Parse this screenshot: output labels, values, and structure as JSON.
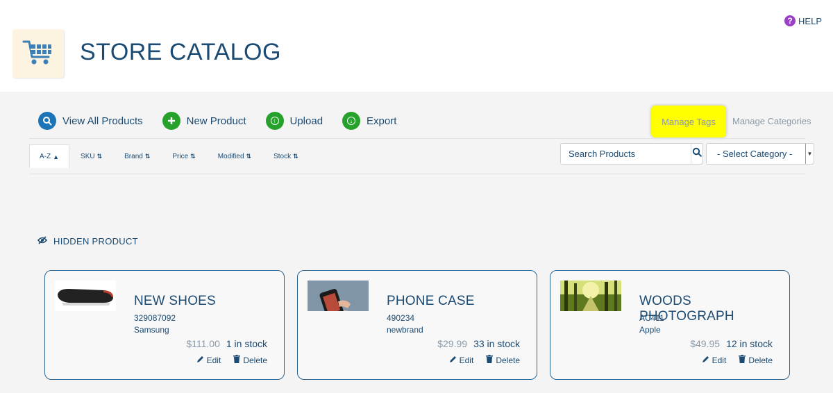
{
  "help": {
    "label": "HELP"
  },
  "header": {
    "title": "STORE CATALOG",
    "logo_icon": "shopping-cart-icon"
  },
  "actions": [
    {
      "label": "View All Products",
      "icon": "search-icon",
      "color": "#1d75b8"
    },
    {
      "label": "New Product",
      "icon": "plus-icon",
      "color": "#26a22c"
    },
    {
      "label": "Upload",
      "icon": "upload-icon",
      "color": "#26a22c"
    },
    {
      "label": "Export",
      "icon": "download-icon",
      "color": "#26a22c"
    }
  ],
  "manage": {
    "tags_label": "Manage Tags",
    "categories_label": "Manage Categories",
    "highlight_color": "#ffff00"
  },
  "sort": {
    "items": [
      {
        "label": "A-Z",
        "arrow": "▲",
        "active": true
      },
      {
        "label": "SKU",
        "arrow": "⇅"
      },
      {
        "label": "Brand",
        "arrow": "⇅"
      },
      {
        "label": "Price",
        "arrow": "⇅"
      },
      {
        "label": "Modified",
        "arrow": "⇅"
      },
      {
        "label": "Stock",
        "arrow": "⇅"
      }
    ]
  },
  "search": {
    "placeholder": "Search Products"
  },
  "category": {
    "selected": "- Select Category -"
  },
  "hidden_section": {
    "label": "HIDDEN PRODUCT",
    "icon": "hidden-eye-icon"
  },
  "products": [
    {
      "name": "NEW SHOES",
      "sku": "329087092",
      "brand": "Samsung",
      "price": "$111.00",
      "stock": "1 in stock",
      "edit": "Edit",
      "delete": "Delete"
    },
    {
      "name": "PHONE CASE",
      "sku": "490234",
      "brand": "newbrand",
      "price": "$29.99",
      "stock": "33 in stock",
      "edit": "Edit",
      "delete": "Delete"
    },
    {
      "name": "WOODS PHOTOGRAPH",
      "sku": "AC411",
      "brand": "Apple",
      "price": "$49.95",
      "stock": "12 in stock",
      "edit": "Edit",
      "delete": "Delete"
    }
  ]
}
